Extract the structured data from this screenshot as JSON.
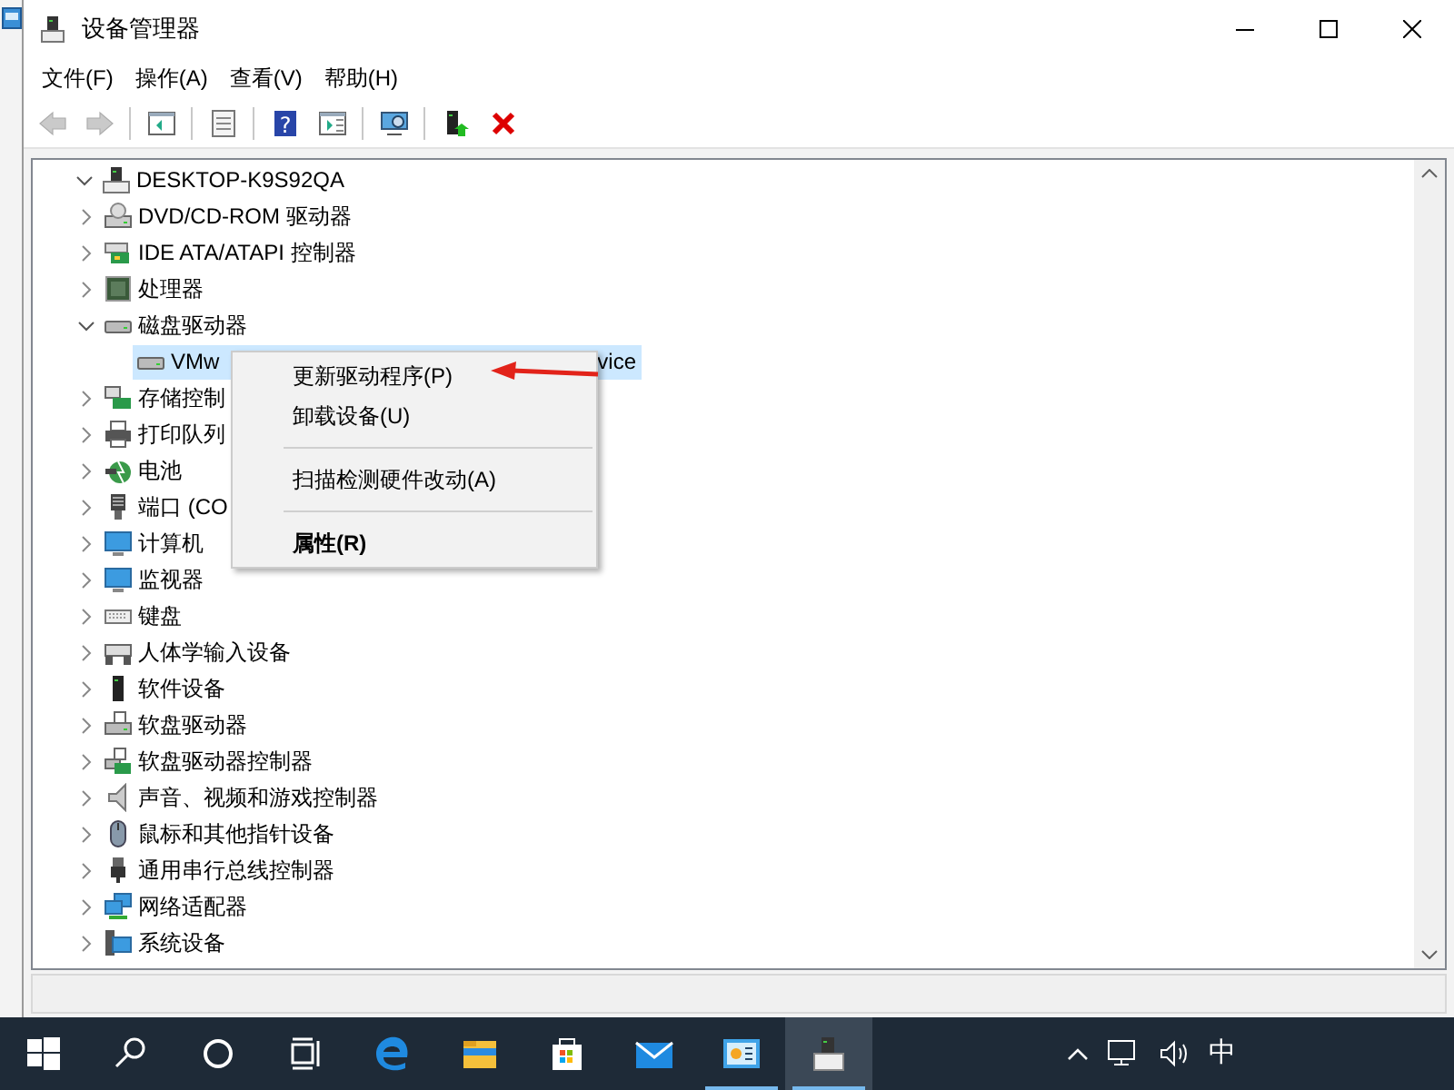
{
  "window": {
    "title": "设备管理器"
  },
  "menu_bar": [
    "文件(F)",
    "操作(A)",
    "查看(V)",
    "帮助(H)"
  ],
  "toolbar": [
    {
      "kind": "button",
      "disabled": true
    },
    {
      "kind": "button",
      "disabled": true
    },
    {
      "kind": "separator"
    },
    {
      "kind": "button",
      "disabled": false
    },
    {
      "kind": "separator"
    },
    {
      "kind": "button",
      "disabled": false
    },
    {
      "kind": "separator"
    },
    {
      "kind": "button",
      "disabled": false,
      "glyph": "?"
    },
    {
      "kind": "button",
      "disabled": false
    },
    {
      "kind": "separator"
    },
    {
      "kind": "button",
      "disabled": false
    },
    {
      "kind": "separator"
    },
    {
      "kind": "button",
      "disabled": false
    },
    {
      "kind": "button",
      "disabled": false
    }
  ],
  "tree": {
    "label": "DESKTOP-K9S92QA",
    "expanded": true,
    "children": [
      {
        "label": "DVD/CD-ROM 驱动器",
        "expanded": false,
        "selected": false
      },
      {
        "label": "IDE ATA/ATAPI 控制器",
        "expanded": false,
        "selected": false
      },
      {
        "label": "处理器",
        "expanded": false,
        "selected": false
      },
      {
        "label": "磁盘驱动器",
        "expanded": true,
        "selected": false,
        "children": [
          {
            "label": "VMw",
            "label_tail": "vice",
            "selected": true
          }
        ]
      },
      {
        "label": "存储控制",
        "expanded": false,
        "selected": false
      },
      {
        "label": "打印队列",
        "expanded": false,
        "selected": false
      },
      {
        "label": "电池",
        "expanded": false,
        "selected": false
      },
      {
        "label": "端口 (CO",
        "expanded": false,
        "selected": false
      },
      {
        "label": "计算机",
        "expanded": false,
        "selected": false
      },
      {
        "label": "监视器",
        "expanded": false,
        "selected": false
      },
      {
        "label": "键盘",
        "expanded": false,
        "selected": false
      },
      {
        "label": "人体学输入设备",
        "expanded": false,
        "selected": false
      },
      {
        "label": "软件设备",
        "expanded": false,
        "selected": false
      },
      {
        "label": "软盘驱动器",
        "expanded": false,
        "selected": false
      },
      {
        "label": "软盘驱动器控制器",
        "expanded": false,
        "selected": false
      },
      {
        "label": "声音、视频和游戏控制器",
        "expanded": false,
        "selected": false
      },
      {
        "label": "鼠标和其他指针设备",
        "expanded": false,
        "selected": false
      },
      {
        "label": "通用串行总线控制器",
        "expanded": false,
        "selected": false
      },
      {
        "label": "网络适配器",
        "expanded": false,
        "selected": false
      },
      {
        "label": "系统设备",
        "expanded": false,
        "selected": false
      }
    ]
  },
  "context_menu": [
    {
      "kind": "item",
      "label": "更新驱动程序(P)",
      "default": false
    },
    {
      "kind": "item",
      "label": "卸载设备(U)",
      "default": false
    },
    {
      "kind": "separator"
    },
    {
      "kind": "item",
      "label": "扫描检测硬件改动(A)",
      "default": false
    },
    {
      "kind": "separator"
    },
    {
      "kind": "item",
      "label": "属性(R)",
      "default": true
    }
  ],
  "taskbar": {
    "apps": [
      {
        "running": false,
        "selected": false
      },
      {
        "running": false,
        "selected": false
      },
      {
        "running": true,
        "selected": false
      },
      {
        "running": true,
        "selected": true
      }
    ],
    "ime": "中"
  }
}
